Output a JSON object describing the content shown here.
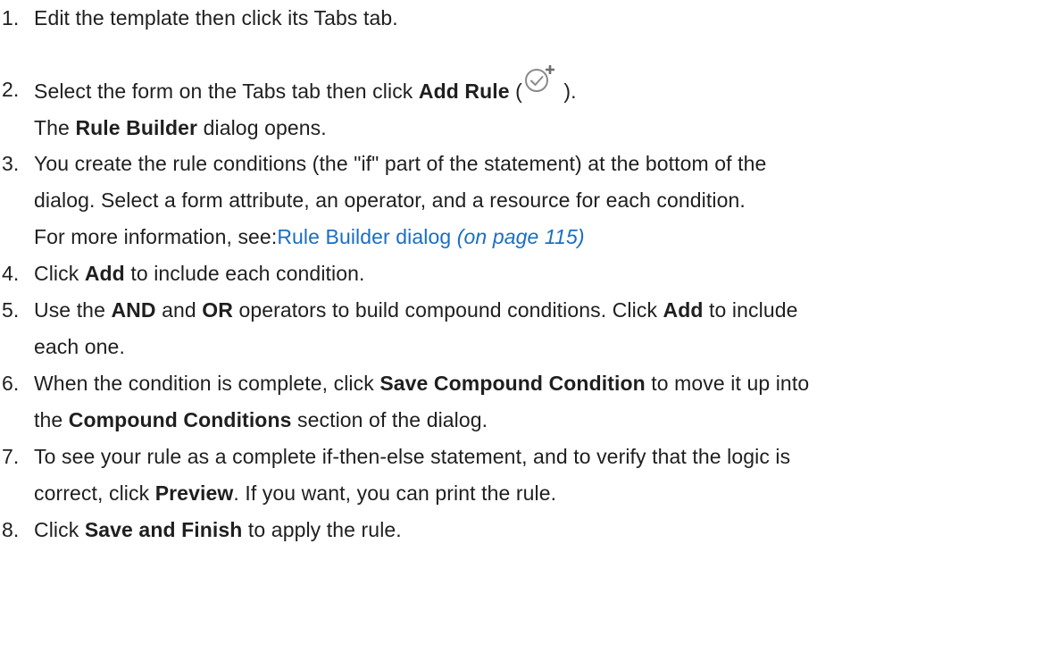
{
  "steps": [
    {
      "num": "1.",
      "text": "Edit the template then click its Tabs tab."
    },
    {
      "num": "2.",
      "pre": "Select the form on the Tabs tab then click ",
      "bold": "Add Rule",
      "open_paren": " (",
      "icon": "add-rule-icon",
      "close_paren": " ).",
      "line2_bold": "Rule Builder",
      "line2_rest": " dialog opens.",
      "line2_pre": "The "
    },
    {
      "num": "3.",
      "line1": "You create the rule conditions (the \"if\" part of the statement) at the bottom of the",
      "line2": "dialog. Select a form attribute, an operator, and a resource for each condition.",
      "line3_pre": "For more information, see:",
      "link_text": "Rule Builder dialog",
      "page_ref": "(on page 115)"
    },
    {
      "num": "4.",
      "pre": "Click ",
      "bold": "Add",
      "post": " to include each condition."
    },
    {
      "num": "5.",
      "pre": "Use the ",
      "bold1": "AND",
      "mid1": " and ",
      "bold2": "OR",
      "mid2": " operators to build compound conditions. Click ",
      "bold3": "Add",
      "post": " to include",
      "line2": "each one."
    },
    {
      "num": "6.",
      "pre": "When the condition is complete, click ",
      "bold": "Save Compound Condition",
      "post": " to move it up into",
      "line2_pre": "the ",
      "line2_bold": "Compound Conditions",
      "line2_post": " section of the dialog."
    },
    {
      "num": "7.",
      "line1": "To see your rule as a complete if-then-else statement, and to verify that the logic is",
      "line2_pre": "correct, click ",
      "line2_bold": "Preview",
      "line2_post": ". If you want, you can print the rule."
    },
    {
      "num": "8.",
      "pre": "Click ",
      "bold": "Save and Finish",
      "post": " to apply the rule."
    }
  ],
  "colors": {
    "text": "#1f1f1f",
    "link": "#1a6fc1",
    "icon": "#8a8a8a"
  }
}
